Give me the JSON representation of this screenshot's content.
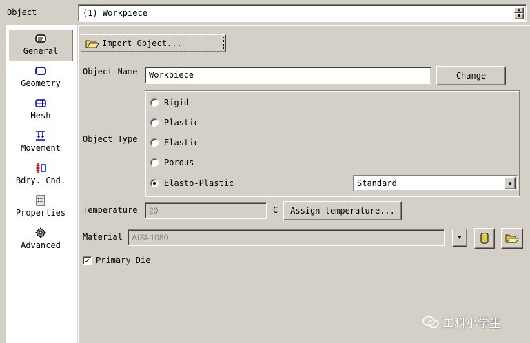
{
  "object_bar": {
    "label": "Object",
    "selected": "(1) Workpiece"
  },
  "nav": {
    "items": [
      {
        "label": "General",
        "icon": "general-icon",
        "active": true
      },
      {
        "label": "Geometry",
        "icon": "geometry-icon",
        "active": false
      },
      {
        "label": "Mesh",
        "icon": "mesh-icon",
        "active": false
      },
      {
        "label": "Movement",
        "icon": "movement-icon",
        "active": false
      },
      {
        "label": "Bdry. Cnd.",
        "icon": "boundary-condition-icon",
        "active": false
      },
      {
        "label": "Properties",
        "icon": "properties-icon",
        "active": false
      },
      {
        "label": "Advanced",
        "icon": "advanced-icon",
        "active": false
      }
    ]
  },
  "general": {
    "import_button": "Import Object...",
    "object_name_label": "Object Name",
    "object_name_value": "Workpiece",
    "change_button": "Change",
    "object_type_label": "Object Type",
    "object_types": [
      {
        "label": "Rigid",
        "checked": false
      },
      {
        "label": "Plastic",
        "checked": false
      },
      {
        "label": "Elastic",
        "checked": false
      },
      {
        "label": "Porous",
        "checked": false
      },
      {
        "label": "Elasto-Plastic",
        "checked": true
      }
    ],
    "elasto_plastic_mode": "Standard",
    "temperature_label": "Temperature",
    "temperature_value": "20",
    "temperature_unit": "C",
    "assign_temperature_button": "Assign temperature...",
    "material_label": "Material",
    "material_value": "AISI-1080",
    "primary_die_label": "Primary Die",
    "primary_die_checked": true
  },
  "watermark": {
    "text": "工科小学生"
  },
  "colors": {
    "panel_bg": "#d4d0c8",
    "nav_bg": "#ffffff",
    "disabled_text": "#808080"
  }
}
